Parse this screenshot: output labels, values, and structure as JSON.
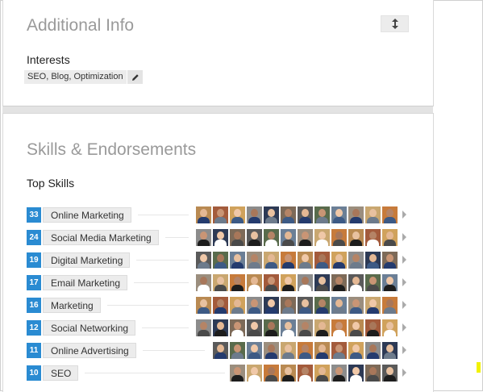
{
  "additional_info": {
    "title": "Additional Info",
    "interests_label": "Interests",
    "interests_value": "SEO, Blog, Optimization",
    "reorder_icon": "up-down-arrow-icon",
    "edit_icon": "pencil-icon"
  },
  "skills": {
    "title": "Skills & Endorsements",
    "top_skills_label": "Top Skills",
    "accent_color": "#2a8bd2",
    "items": [
      {
        "count": "33",
        "name": "Online Marketing",
        "avatars": 12
      },
      {
        "count": "24",
        "name": "Social Media Marketing",
        "avatars": 12
      },
      {
        "count": "19",
        "name": "Digital Marketing",
        "avatars": 12
      },
      {
        "count": "17",
        "name": "Email Marketing",
        "avatars": 12
      },
      {
        "count": "16",
        "name": "Marketing",
        "avatars": 12
      },
      {
        "count": "12",
        "name": "Social Networking",
        "avatars": 12
      },
      {
        "count": "11",
        "name": "Online Advertising",
        "avatars": 11
      },
      {
        "count": "10",
        "name": "SEO",
        "avatars": 10
      }
    ]
  }
}
